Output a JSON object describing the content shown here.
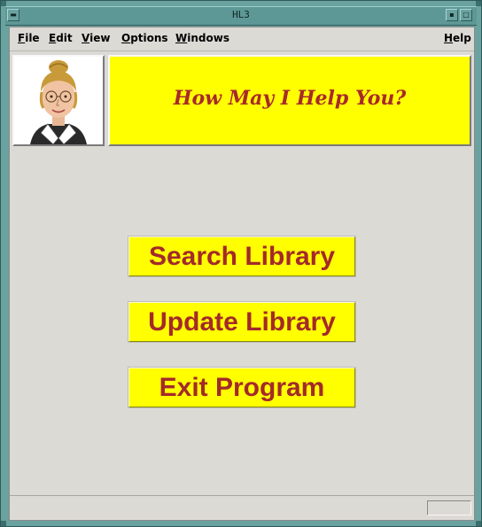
{
  "window": {
    "title": "HL3"
  },
  "menubar": {
    "items": [
      {
        "first": "F",
        "rest": "ile"
      },
      {
        "first": "E",
        "rest": "dit"
      },
      {
        "first": "V",
        "rest": "iew"
      },
      {
        "first": "O",
        "rest": "ptions"
      },
      {
        "first": "W",
        "rest": "indows"
      },
      {
        "first": "H",
        "rest": "elp"
      }
    ]
  },
  "banner": {
    "text": "How May I Help You?"
  },
  "buttons": {
    "search": "Search Library",
    "update": "Update Library",
    "exit": "Exit Program"
  },
  "colors": {
    "accent": "#ffff00",
    "text": "#a32a2a",
    "frame": "#6aa2a0"
  }
}
